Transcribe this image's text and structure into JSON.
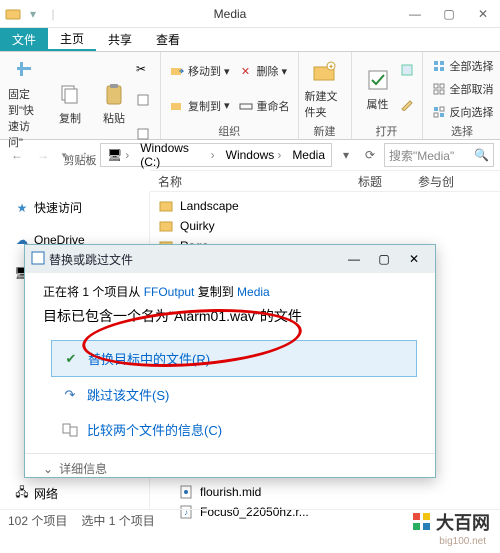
{
  "window": {
    "title": "Media",
    "min": "—",
    "max": "▢",
    "close": "✕"
  },
  "tabs": {
    "file": "文件",
    "home": "主页",
    "share": "共享",
    "view": "查看"
  },
  "ribbon": {
    "clipboard": {
      "pin": "固定到\"快速访问\"",
      "copy": "复制",
      "paste": "粘贴",
      "group": "剪贴板"
    },
    "organize": {
      "moveto": "移动到",
      "copyto": "复制到",
      "delete": "删除",
      "rename": "重命名",
      "group": "组织"
    },
    "new": {
      "newfolder": "新建文件夹",
      "group": "新建"
    },
    "open": {
      "props": "属性",
      "group": "打开"
    },
    "select": {
      "all": "全部选择",
      "none": "全部取消",
      "invert": "反向选择",
      "group": "选择"
    }
  },
  "breadcrumb": {
    "drive": "Windows (C:)",
    "p1": "Windows",
    "p2": "Media"
  },
  "search": {
    "placeholder": "搜索\"Media\""
  },
  "columns": {
    "name": "名称",
    "title": "标题",
    "contrib": "参与创"
  },
  "nav": {
    "quick": "快速访问",
    "onedrive": "OneDrive",
    "thispc": "此电脑",
    "network": "网络"
  },
  "files": {
    "f1": "Landscape",
    "f2": "Quirky",
    "f3": "Raga",
    "f4": "flourish.mid",
    "f5": "Focus0_22050hz.r..."
  },
  "dialog": {
    "title": "替换或跳过文件",
    "line1_a": "正在将 1 个项目从 ",
    "line1_link1": "FFOutput",
    "line1_b": " 复制到 ",
    "line1_link2": "Media",
    "line2_a": "目标已包含一个名为\"",
    "filename": "Alarm01.wav",
    "line2_b": "\"的文件",
    "opt_replace": "替换目标中的文件(R)",
    "opt_skip": "跳过该文件(S)",
    "opt_compare": "比较两个文件的信息(C)",
    "more": "详细信息"
  },
  "status": {
    "count": "102 个项目",
    "sel": "选中 1 个项目"
  },
  "watermark": {
    "text": "大百网",
    "url": "big100.net"
  }
}
